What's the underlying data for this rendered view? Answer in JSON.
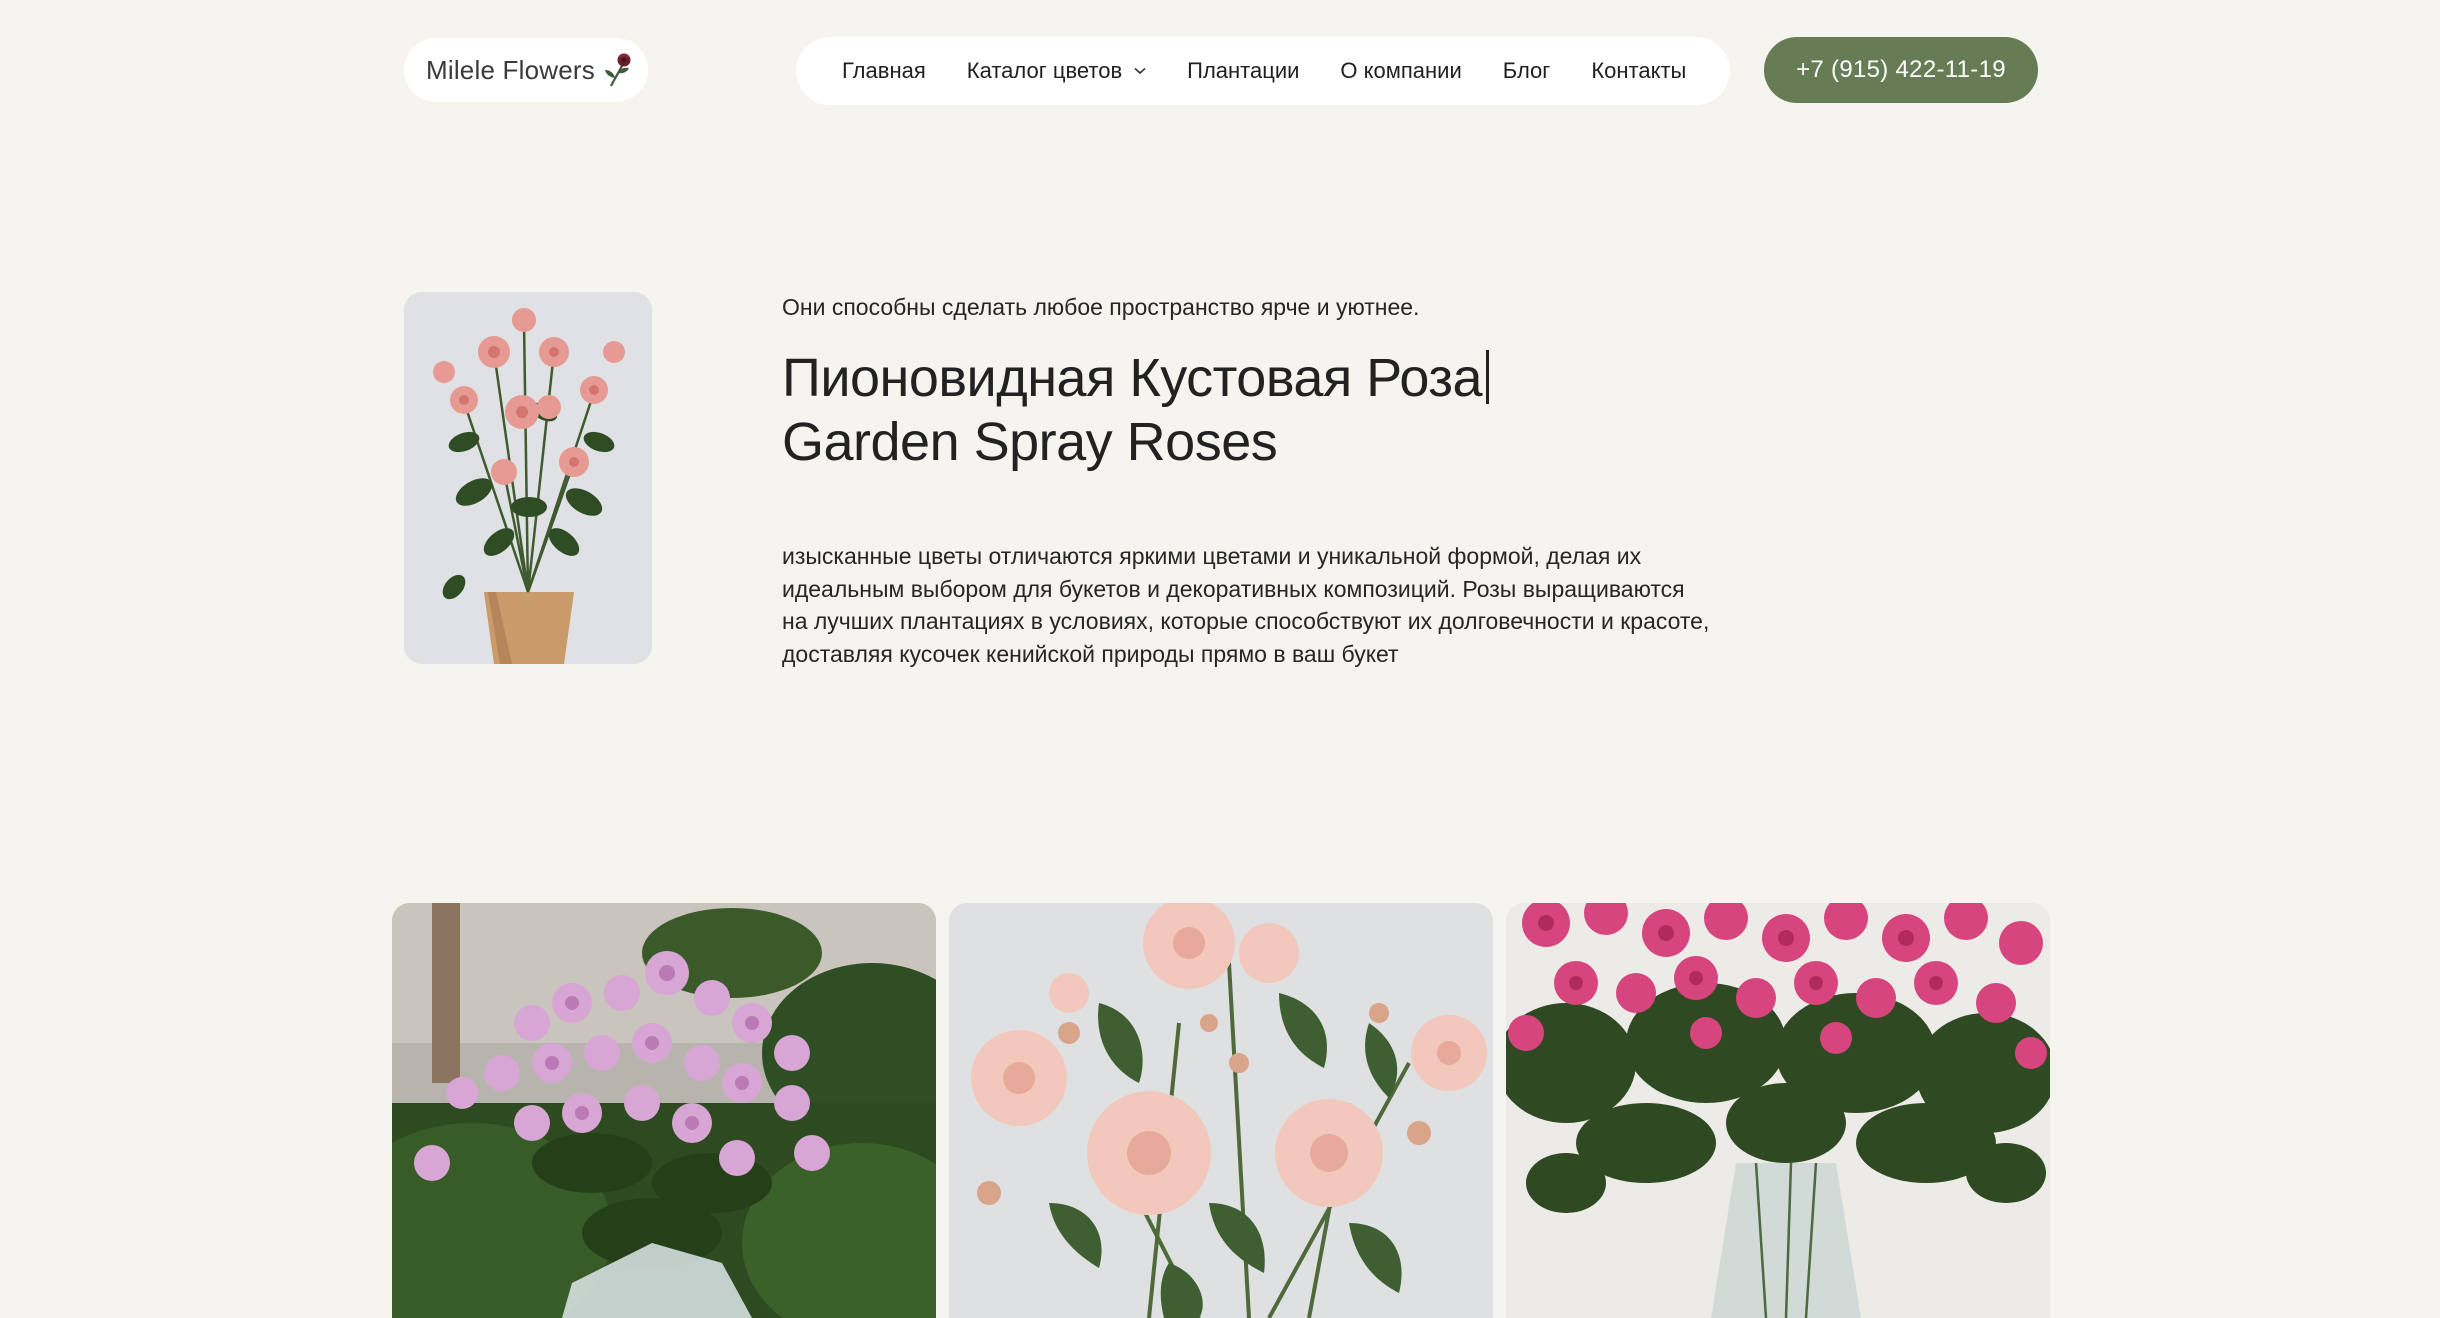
{
  "header": {
    "logo_text": "Milele Flowers",
    "nav": [
      {
        "label": "Главная"
      },
      {
        "label": "Каталог цветов",
        "has_dropdown": true
      },
      {
        "label": "Плантации"
      },
      {
        "label": "О компании"
      },
      {
        "label": "Блог"
      },
      {
        "label": "Контакты"
      }
    ],
    "phone": "+7 (915) 422-11-19"
  },
  "hero": {
    "subtitle": "Они способны сделать любое пространство ярче и уютнее.",
    "title_line1": "Пионовидная Кустовая Роза",
    "title_line2": "Garden Spray Roses",
    "description": "изысканные цветы отличаются яркими цветами и уникальной формой, делая их идеальным выбором для букетов и декоративных композиций. Розы выращиваются на лучших плантациях в условиях, которые способствуют их долговечности и красоте, доставляя кусочек кенийской природы прямо в ваш букет"
  },
  "colors": {
    "background": "#f6f4ee",
    "accent_green": "#667c55",
    "surface": "#ffffff",
    "text": "#1f1f1f"
  }
}
